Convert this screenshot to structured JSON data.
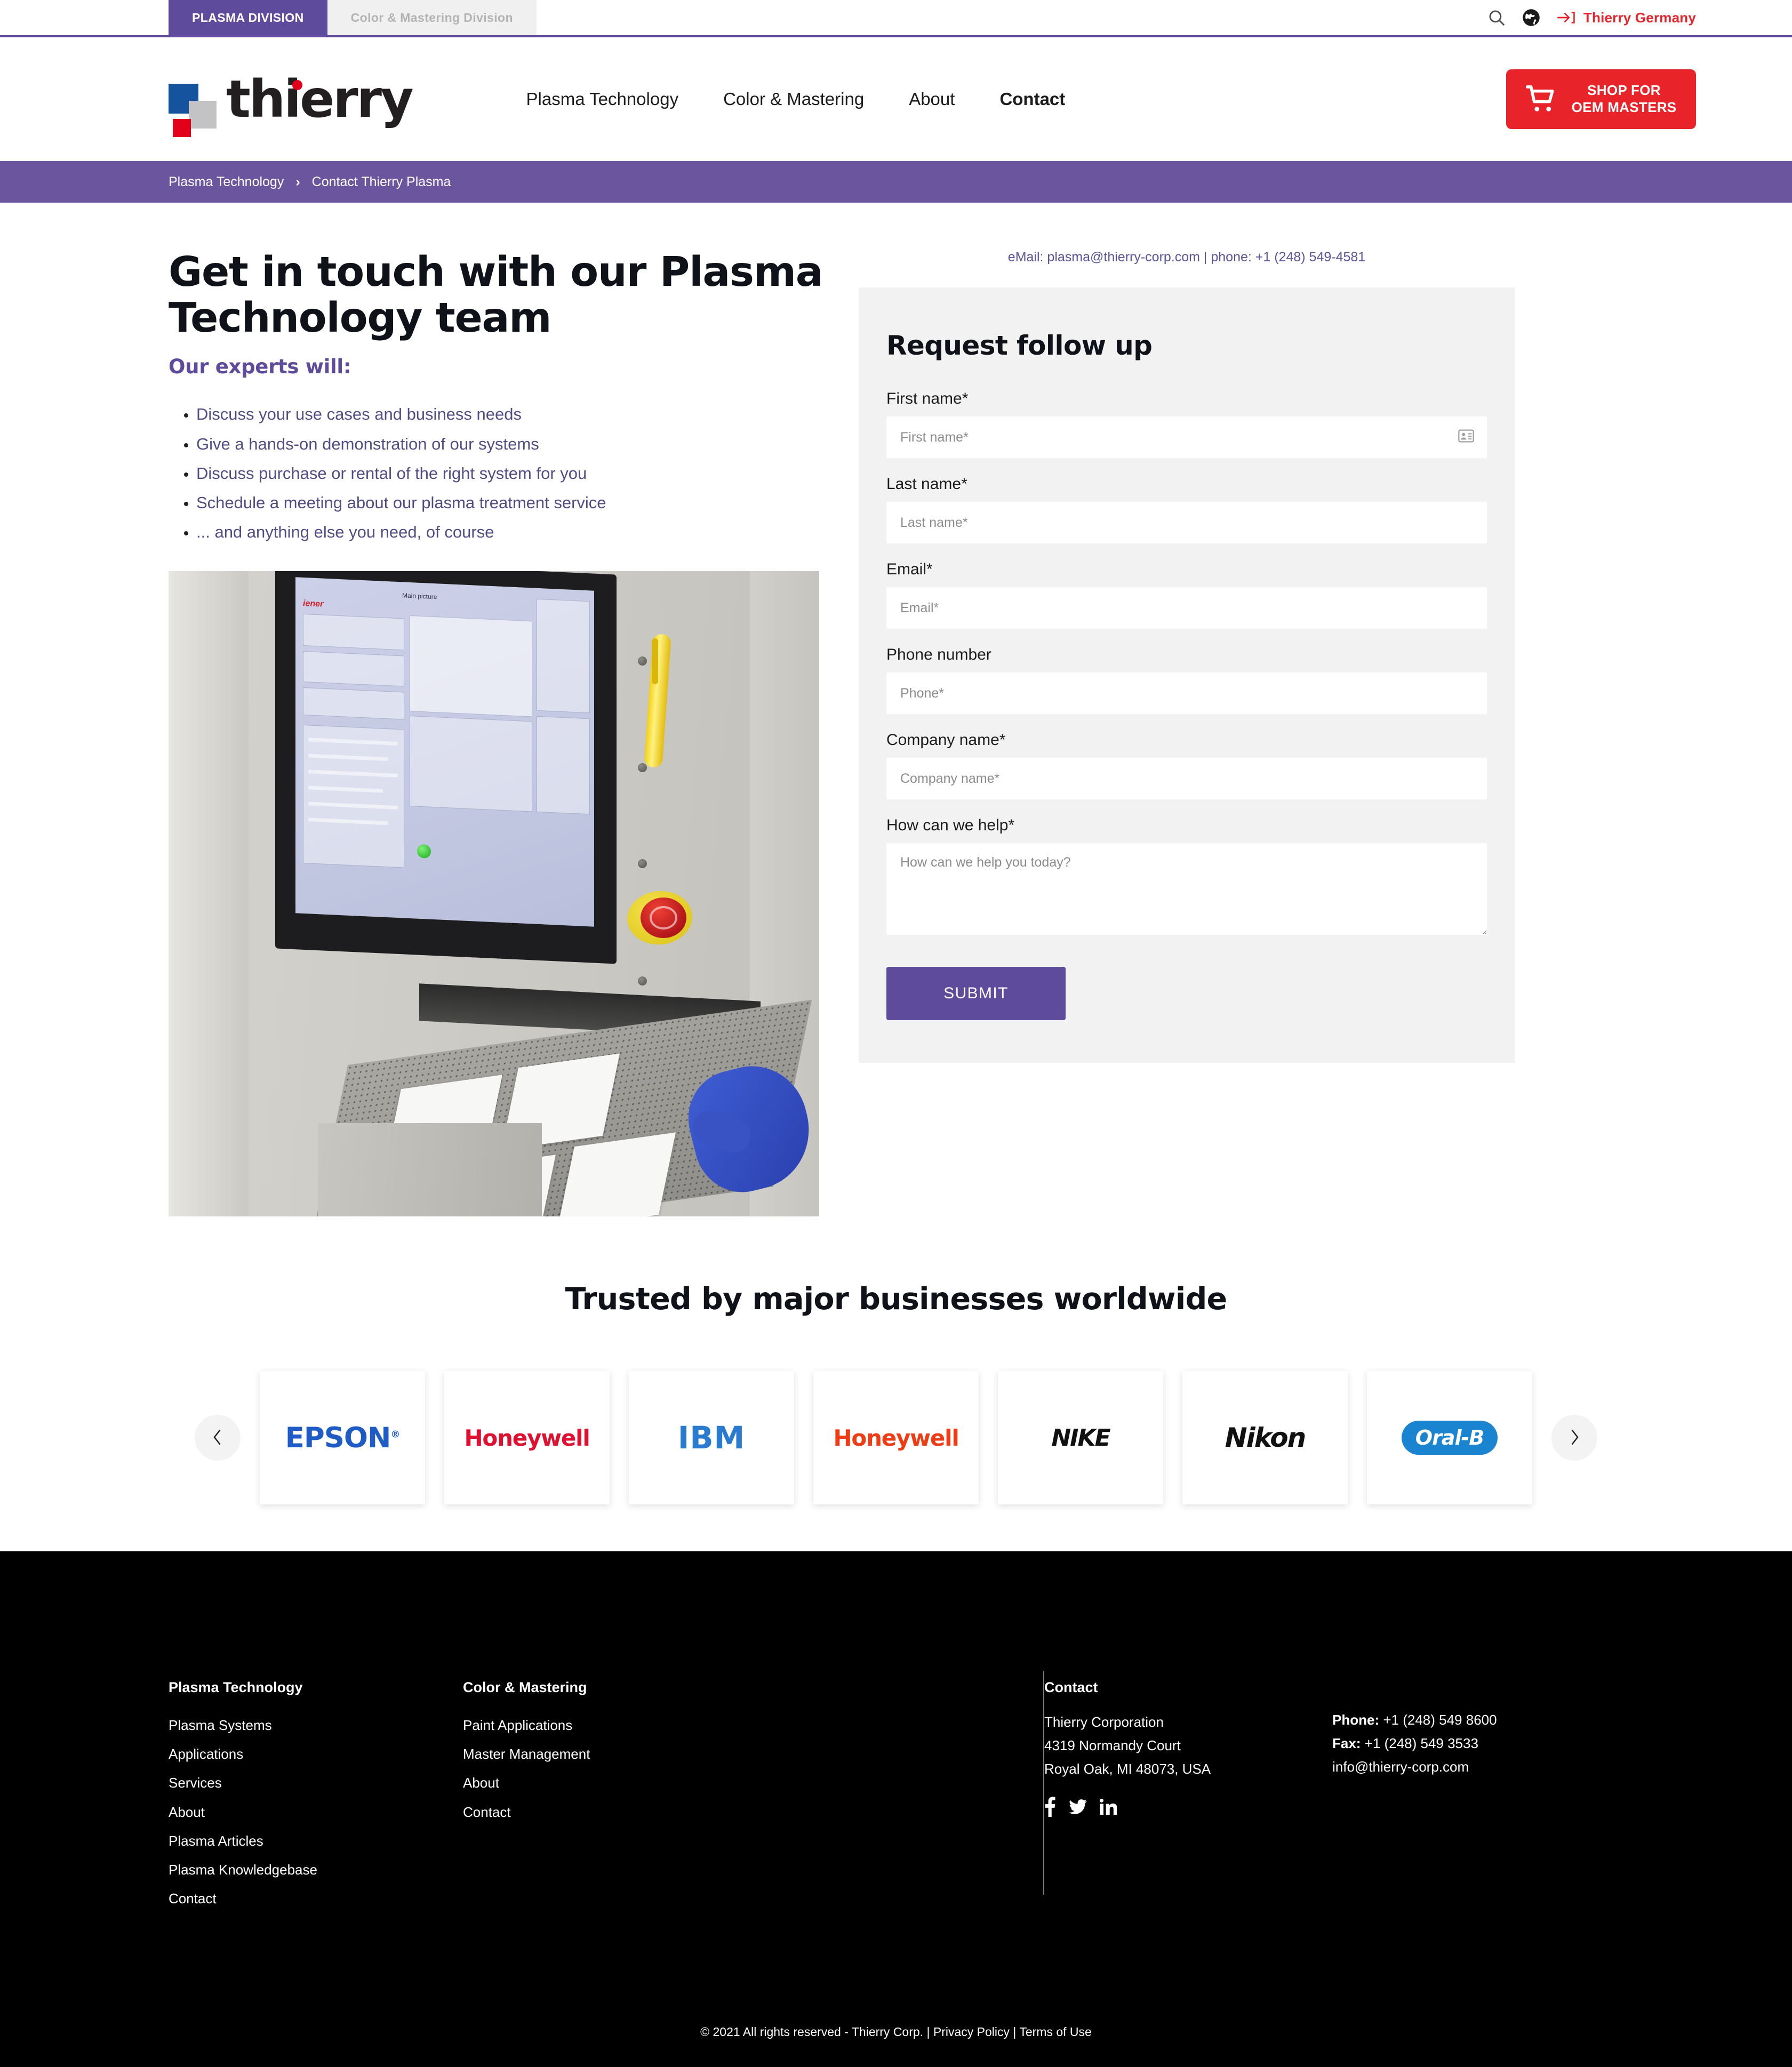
{
  "topbar": {
    "divisions": [
      {
        "label": "PLASMA DIVISION",
        "active": true
      },
      {
        "label": "Color & Mastering Division",
        "active": false
      }
    ],
    "search_icon": "search-icon",
    "globe_icon": "globe-icon",
    "login_icon": "login-arrow-icon",
    "login_label": "Thierry Germany",
    "login_color": "#e8232a",
    "accent_purple": "#5e4b9b"
  },
  "header": {
    "logo_text": "thierry",
    "nav": [
      {
        "label": "Plasma Technology",
        "current": false
      },
      {
        "label": "Color & Mastering",
        "current": false
      },
      {
        "label": "About",
        "current": false
      },
      {
        "label": "Contact",
        "current": true
      }
    ],
    "shop_button": {
      "line1": "SHOP FOR",
      "line2": "OEM MASTERS",
      "icon": "shopping-cart-icon",
      "color": "#e8232a"
    }
  },
  "breadcrumb": {
    "items": [
      "Plasma Technology",
      "Contact Thierry Plasma"
    ],
    "separator": "›",
    "background": "#6b559f"
  },
  "main": {
    "title": "Get in touch with our Plasma Technology team",
    "subtitle": "Our experts will:",
    "bullets": [
      "Discuss your use cases and business needs",
      "Give a hands-on demonstration of our systems",
      "Discuss purchase or rental of the right system for you",
      "Schedule a meeting about our plasma treatment service",
      "... and anything else you need, of course"
    ],
    "photo_alt": "Plasma treatment machine with touchscreen control panel and operator loading ceramic tiles"
  },
  "form": {
    "contact_line": "eMail: plasma@thierry-corp.com | phone: +1 (248) 549-4581",
    "email": "plasma@thierry-corp.com",
    "phone": "+1 (248) 549-4581",
    "heading": "Request follow up",
    "fields": [
      {
        "label": "First name*",
        "placeholder": "First name*",
        "value": "",
        "icon": "contact-card-icon"
      },
      {
        "label": "Last name*",
        "placeholder": "Last name*",
        "value": ""
      },
      {
        "label": "Email*",
        "placeholder": "Email*",
        "value": ""
      },
      {
        "label": "Phone number",
        "placeholder": "Phone*",
        "value": ""
      },
      {
        "label": "Company name*",
        "placeholder": "Company name*",
        "value": ""
      }
    ],
    "textarea": {
      "label": "How can we help*",
      "placeholder": "How can we help you today?",
      "value": ""
    },
    "submit_label": "SUBMIT",
    "submit_color": "#5e4b9b",
    "panel_background": "#f2f2f2"
  },
  "trusted": {
    "heading": "Trusted by major businesses worldwide",
    "prev_icon": "chevron-left-icon",
    "next_icon": "chevron-right-icon",
    "logos": [
      {
        "name": "EPSON",
        "style": "epson"
      },
      {
        "name": "Honeywell",
        "style": "honeywell-red"
      },
      {
        "name": "IBM",
        "style": "ibm"
      },
      {
        "name": "Honeywell",
        "style": "honeywell-orange"
      },
      {
        "name": "NIKE",
        "style": "nike"
      },
      {
        "name": "Nikon",
        "style": "nikon"
      },
      {
        "name": "Oral-B",
        "style": "oralb"
      }
    ]
  },
  "footer": {
    "col1": {
      "heading": "Plasma Technology",
      "links": [
        "Plasma Systems",
        "Applications",
        "Services",
        "About",
        "Plasma Articles",
        "Plasma Knowledgebase",
        "Contact"
      ]
    },
    "col2": {
      "heading": "Color & Mastering",
      "links": [
        "Paint Applications",
        "Master Management",
        "About",
        "Contact"
      ]
    },
    "contact": {
      "heading": "Contact",
      "company": "Thierry Corporation",
      "street": "4319 Normandy Court",
      "city": "Royal Oak, MI 48073, USA",
      "phone_label": "Phone:",
      "phone": "+1 (248) 549 8600",
      "fax_label": "Fax:",
      "fax": "+1 (248) 549 3533",
      "email": "info@thierry-corp.com",
      "socials": [
        "facebook-icon",
        "twitter-icon",
        "linkedin-icon"
      ]
    },
    "copyright": "© 2021 All rights reserved - Thierry Corp. |",
    "privacy": "Privacy Policy",
    "pipe": "|",
    "terms": "Terms of Use"
  }
}
